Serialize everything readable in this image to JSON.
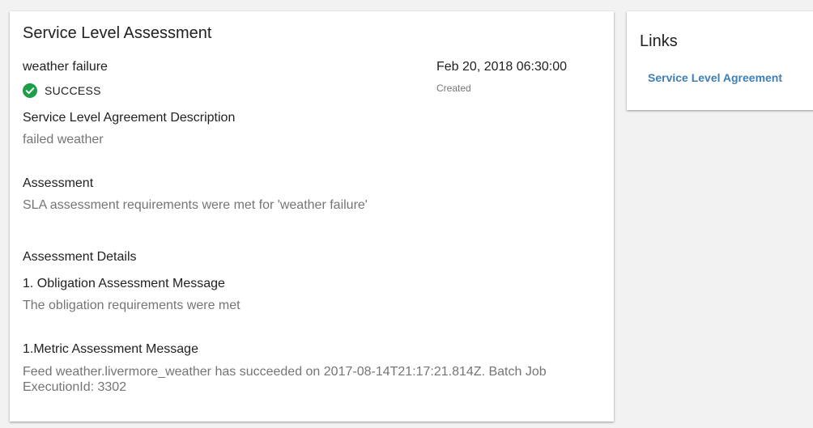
{
  "main": {
    "title": "Service Level Assessment",
    "sla_name": "weather failure",
    "status": {
      "label": "SUCCESS",
      "color": "#1e9e4a",
      "icon": "check-circle-icon"
    },
    "created": {
      "value": "Feb 20, 2018 06:30:00",
      "label": "Created"
    },
    "description": {
      "heading": "Service Level Agreement Description",
      "value": "failed weather"
    },
    "assessment": {
      "heading": "Assessment",
      "value": "SLA assessment requirements were met for 'weather failure'"
    },
    "details": {
      "heading": "Assessment Details",
      "obligation": {
        "heading": "1. Obligation Assessment Message",
        "value": "The obligation requirements were met"
      },
      "metric": {
        "heading": "1.Metric Assessment Message",
        "value": "Feed weather.livermore_weather has succeeded on 2017-08-14T21:17:21.814Z. Batch Job ExecutionId: 3302"
      }
    }
  },
  "links": {
    "title": "Links",
    "items": [
      {
        "label": "Service Level Agreement",
        "color": "#3d7fb6"
      }
    ]
  }
}
